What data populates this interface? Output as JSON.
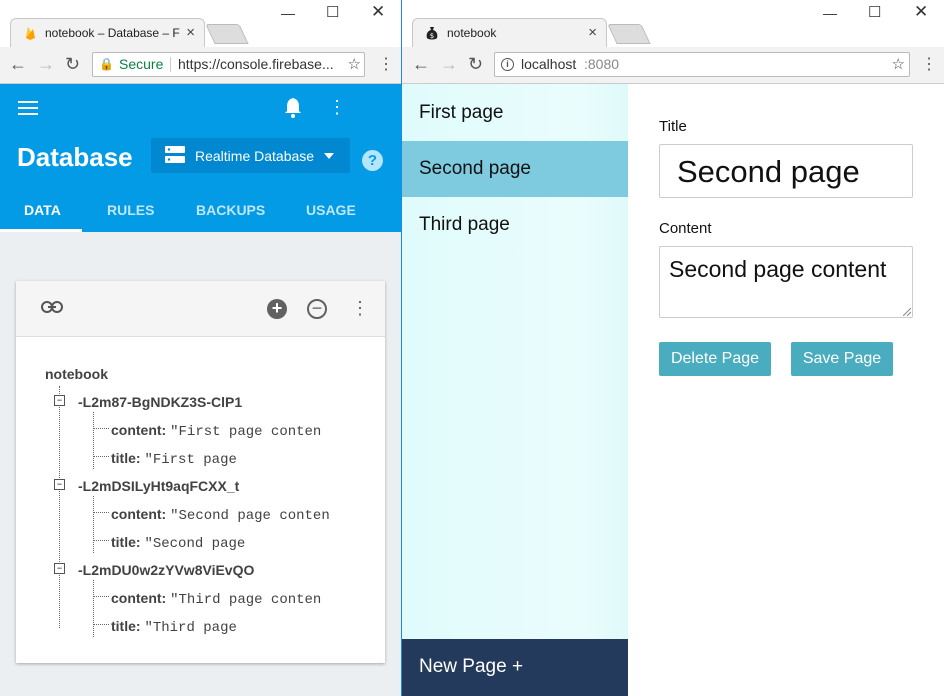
{
  "left_window": {
    "tab_title": "notebook – Database – F",
    "secure_label": "Secure",
    "url": "https://console.firebase...",
    "header": {
      "title": "Database",
      "db_selector": "Realtime Database",
      "tabs": [
        "DATA",
        "RULES",
        "BACKUPS",
        "USAGE"
      ]
    },
    "tree": {
      "root": "notebook",
      "nodes": [
        {
          "key": "-L2m87-BgNDKZ3S-ClP1",
          "content_label": "content:",
          "content_value": "\"First page conten",
          "title_label": "title:",
          "title_value": "\"First page"
        },
        {
          "key": "-L2mDSILyHt9aqFCXX_t",
          "content_label": "content:",
          "content_value": "\"Second page conten",
          "title_label": "title:",
          "title_value": "\"Second page"
        },
        {
          "key": "-L2mDU0w2zYVw8ViEvQO",
          "content_label": "content:",
          "content_value": "\"Third page conten",
          "title_label": "title:",
          "title_value": "\"Third page"
        }
      ]
    }
  },
  "right_window": {
    "tab_title": "notebook",
    "url_host": "localhost",
    "url_port": ":8080",
    "sidebar": {
      "items": [
        "First page",
        "Second page",
        "Third page"
      ],
      "new_page": "New Page +"
    },
    "editor": {
      "title_label": "Title",
      "title_value": "Second page",
      "content_label": "Content",
      "content_value": "Second page content",
      "delete_button": "Delete Page",
      "save_button": "Save Page"
    }
  },
  "colors": {
    "firebase_blue": "#039be5",
    "active_item": "#7ecbe0",
    "button": "#4aacbf",
    "new_page_bg": "#233a5c"
  }
}
